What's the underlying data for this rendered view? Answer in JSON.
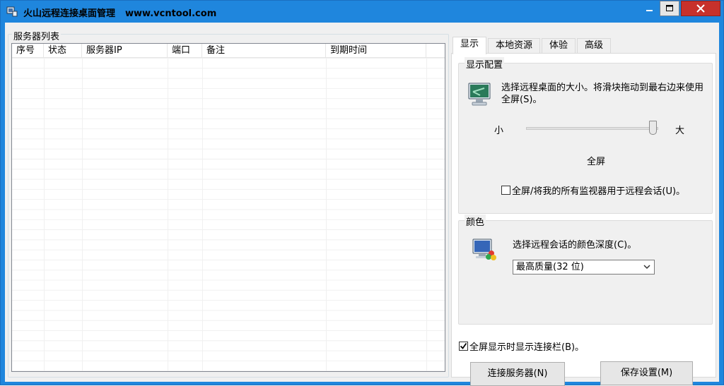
{
  "window": {
    "title": "火山远程连接桌面管理",
    "url": "www.vcntool.com"
  },
  "server_list": {
    "label": "服务器列表",
    "columns": [
      "序号",
      "状态",
      "服务器IP",
      "端口",
      "备注",
      "到期时间"
    ],
    "rows": []
  },
  "tabs": [
    {
      "label": "显示",
      "active": true
    },
    {
      "label": "本地资源",
      "active": false
    },
    {
      "label": "体验",
      "active": false
    },
    {
      "label": "高级",
      "active": false
    }
  ],
  "display": {
    "legend": "显示配置",
    "description": "选择远程桌面的大小。将滑块拖动到最右边来使用全屏(S)。",
    "slider_min": "小",
    "slider_max": "大",
    "slider_value": "全屏",
    "slider_fraction": 1.0,
    "multi_monitor_label": "全屏/将我的所有监视器用于远程会话(U)。",
    "multi_monitor_checked": false
  },
  "color": {
    "legend": "颜色",
    "description": "选择远程会话的颜色深度(C)。",
    "selected": "最高质量(32 位)"
  },
  "connection_bar": {
    "label": "全屏显示时显示连接栏(B)。",
    "checked": true
  },
  "buttons": {
    "connect": "连接服务器(N)",
    "save": "保存设置(M)"
  },
  "colors": {
    "title_bar": "#1f86dd",
    "close_button": "#c7312b"
  }
}
